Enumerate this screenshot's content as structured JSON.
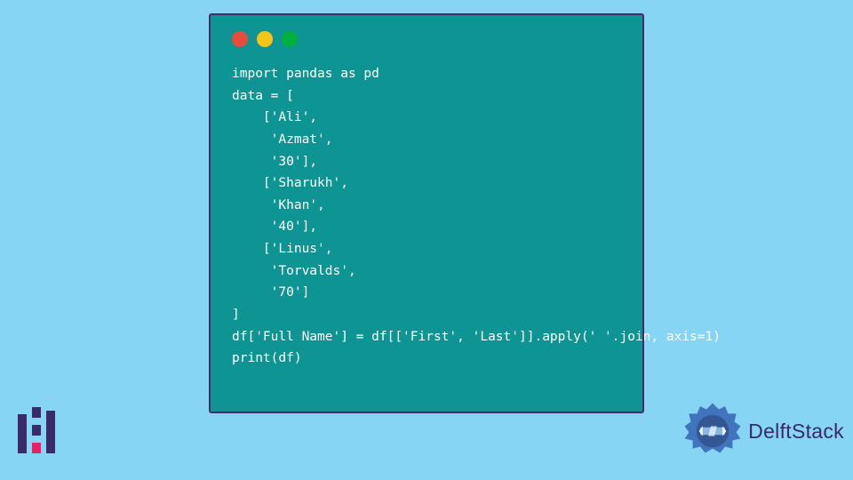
{
  "code": {
    "lines": [
      "import pandas as pd",
      "data = [",
      "    ['Ali',",
      "     'Azmat',",
      "     '30'],",
      "    ['Sharukh',",
      "     'Khan',",
      "     '40'],",
      "    ['Linus',",
      "     'Torvalds',",
      "     '70']",
      "]",
      "df['Full Name'] = df[['First', 'Last']].apply(' '.join, axis=1)",
      "print(df)"
    ]
  },
  "brand": {
    "name": "DelftStack"
  }
}
